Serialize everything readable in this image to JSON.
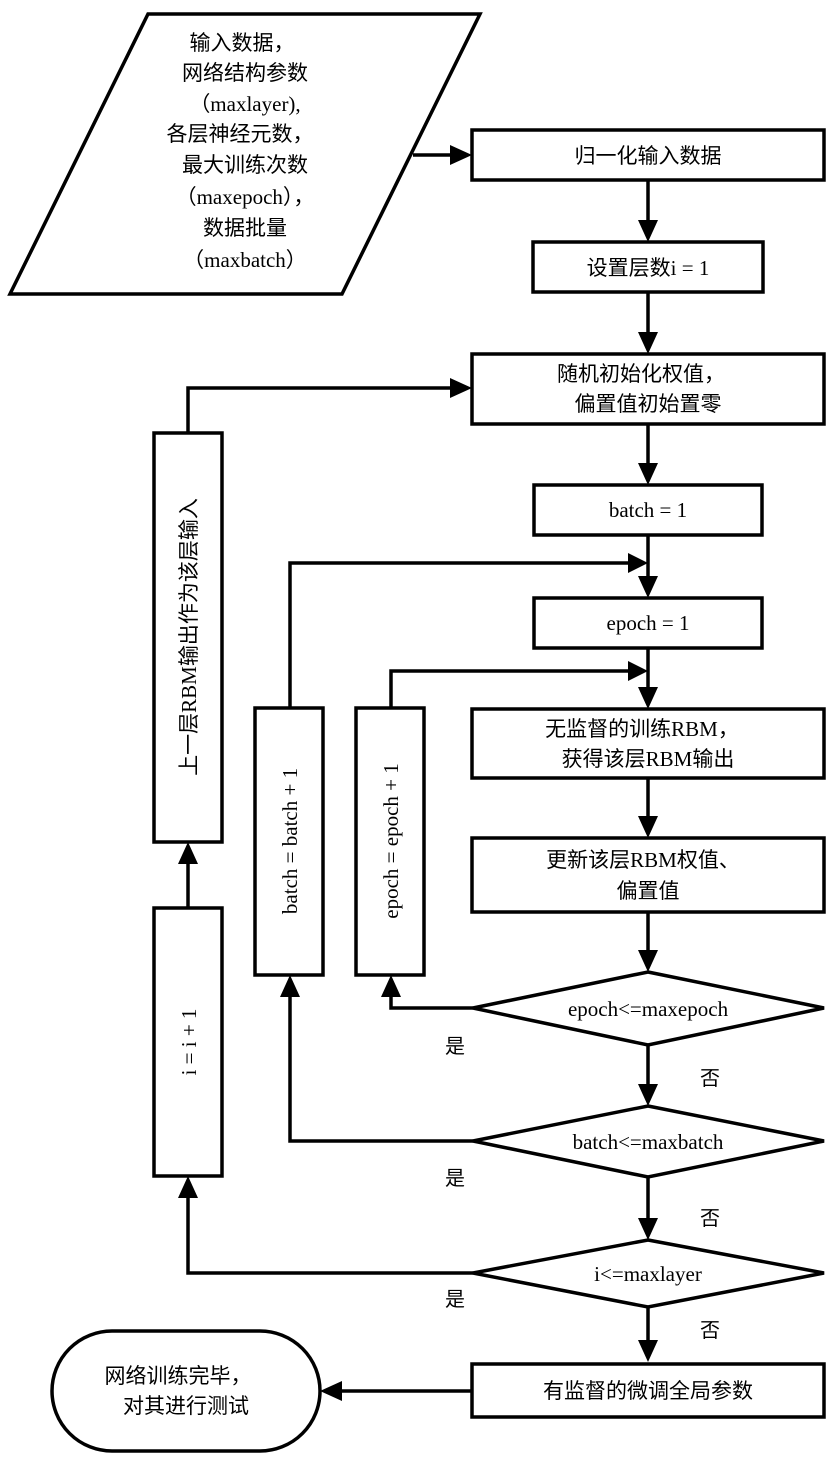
{
  "diagram": {
    "type": "flowchart",
    "subject": "DBN layer-wise RBM pretraining procedure",
    "input_node": {
      "lines": [
        "输入数据，",
        "网络结构参数",
        "（maxlayer),",
        "各层神经元数，",
        "最大训练次数",
        "（maxepoch），",
        "数据批量",
        "（maxbatch）"
      ]
    },
    "nodes": {
      "normalize": "归一化输入数据",
      "set_layer": "设置层数i = 1",
      "init_weights": [
        "随机初始化权值，",
        "偏置值初始置零"
      ],
      "batch_init": "batch = 1",
      "epoch_init": "epoch = 1",
      "train_rbm": [
        "无监督的训练RBM，",
        "获得该层RBM输出"
      ],
      "update_rbm": [
        "更新该层RBM权值、",
        "偏置值"
      ],
      "cond_epoch": "epoch<=maxepoch",
      "cond_batch": "batch<=maxbatch",
      "cond_layer": "i<=maxlayer",
      "finetune": "有监督的微调全局参数",
      "end": [
        "网络训练完毕，",
        "对其进行测试"
      ],
      "epoch_inc": "epoch = epoch + 1",
      "batch_inc": "batch = batch + 1",
      "layer_inc": "i = i + 1",
      "prev_output": "上一层RBM输出作为该层输入"
    },
    "branch_labels": {
      "yes": "是",
      "no": "否"
    }
  }
}
